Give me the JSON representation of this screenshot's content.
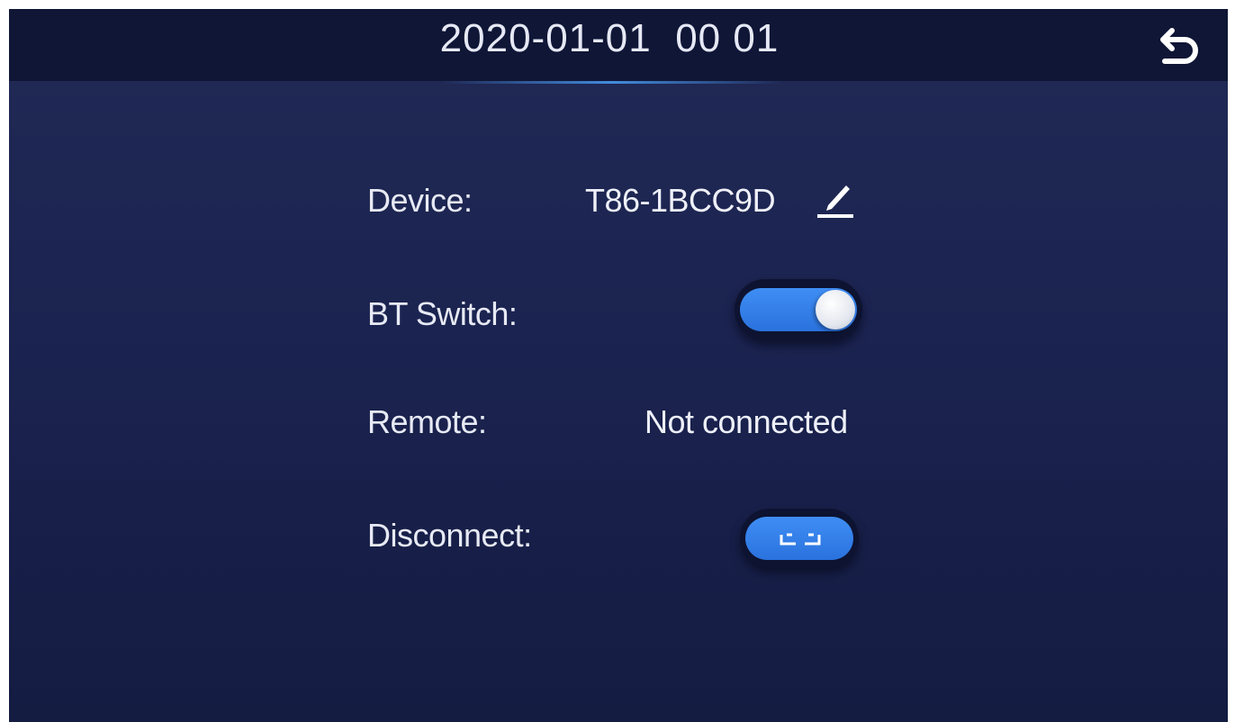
{
  "header": {
    "datetime": "2020-01-01  00 01",
    "back_icon": "back-arrow-icon"
  },
  "rows": {
    "device": {
      "label": "Device:",
      "value": "T86-1BCC9D",
      "edit_icon": "pencil-icon"
    },
    "bt_switch": {
      "label": "BT Switch:",
      "enabled": true
    },
    "remote": {
      "label": "Remote:",
      "value": "Not connected"
    },
    "disconnect": {
      "label": "Disconnect:",
      "icon": "unlink-icon"
    }
  },
  "colors": {
    "background": "#1b2350",
    "header": "#0f1636",
    "accent": "#3585ec",
    "text": "#e7eaf4"
  }
}
